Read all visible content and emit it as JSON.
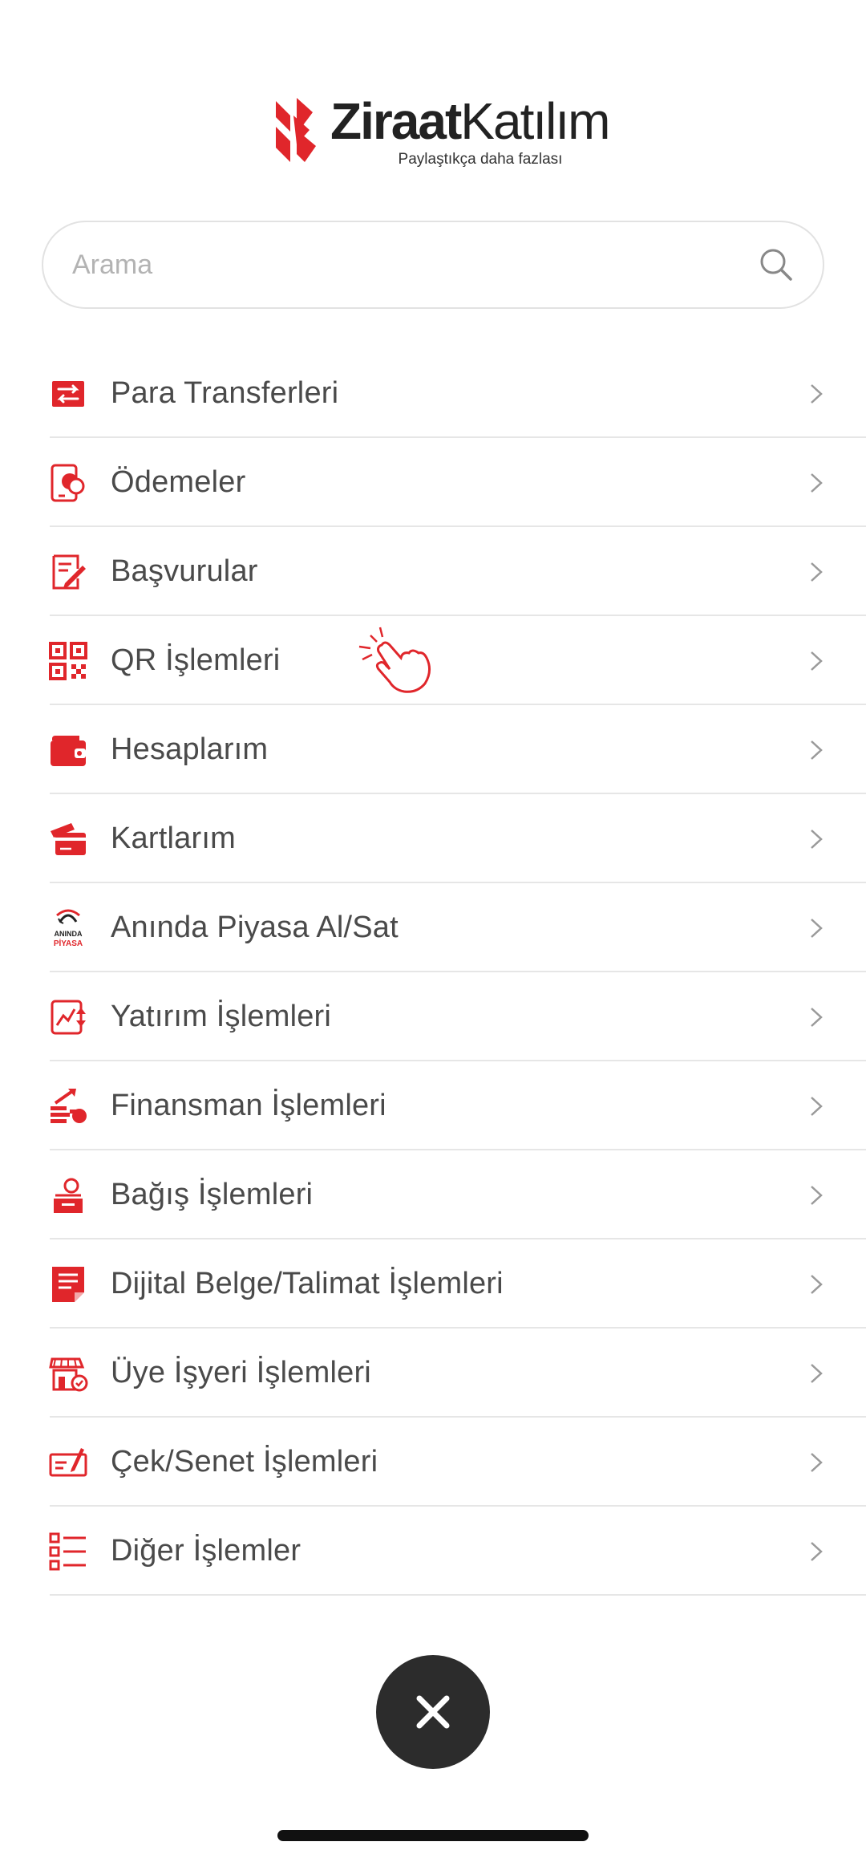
{
  "brand": {
    "name_bold": "Ziraat",
    "name_regular": "Katılım",
    "tagline": "Paylaştıkça daha fazlası",
    "accent": "#e0262b"
  },
  "search": {
    "placeholder": "Arama",
    "value": ""
  },
  "menu": {
    "items": [
      {
        "label": "Para Transferleri",
        "icon": "transfer-arrows-icon"
      },
      {
        "label": "Ödemeler",
        "icon": "payments-phone-icon"
      },
      {
        "label": "Başvurular",
        "icon": "application-form-icon"
      },
      {
        "label": "QR İşlemleri",
        "icon": "qr-code-icon"
      },
      {
        "label": "Hesaplarım",
        "icon": "wallet-icon"
      },
      {
        "label": "Kartlarım",
        "icon": "cards-icon"
      },
      {
        "label": "Anında Piyasa Al/Sat",
        "icon": "aninda-piyasa-icon",
        "icon_text": [
          "ANINDA",
          "PİYASA"
        ]
      },
      {
        "label": "Yatırım İşlemleri",
        "icon": "investment-chart-icon"
      },
      {
        "label": "Finansman İşlemleri",
        "icon": "financing-coins-icon"
      },
      {
        "label": "Bağış İşlemleri",
        "icon": "donation-box-icon"
      },
      {
        "label": "Dijital Belge/Talimat İşlemleri",
        "icon": "digital-document-icon"
      },
      {
        "label": "Üye İşyeri İşlemleri",
        "icon": "merchant-store-icon"
      },
      {
        "label": "Çek/Senet İşlemleri",
        "icon": "cheque-icon"
      },
      {
        "label": "Diğer İşlemler",
        "icon": "list-icon"
      }
    ]
  },
  "hint": {
    "icon": "tap-hand-icon"
  },
  "close": {
    "icon": "close-icon"
  }
}
